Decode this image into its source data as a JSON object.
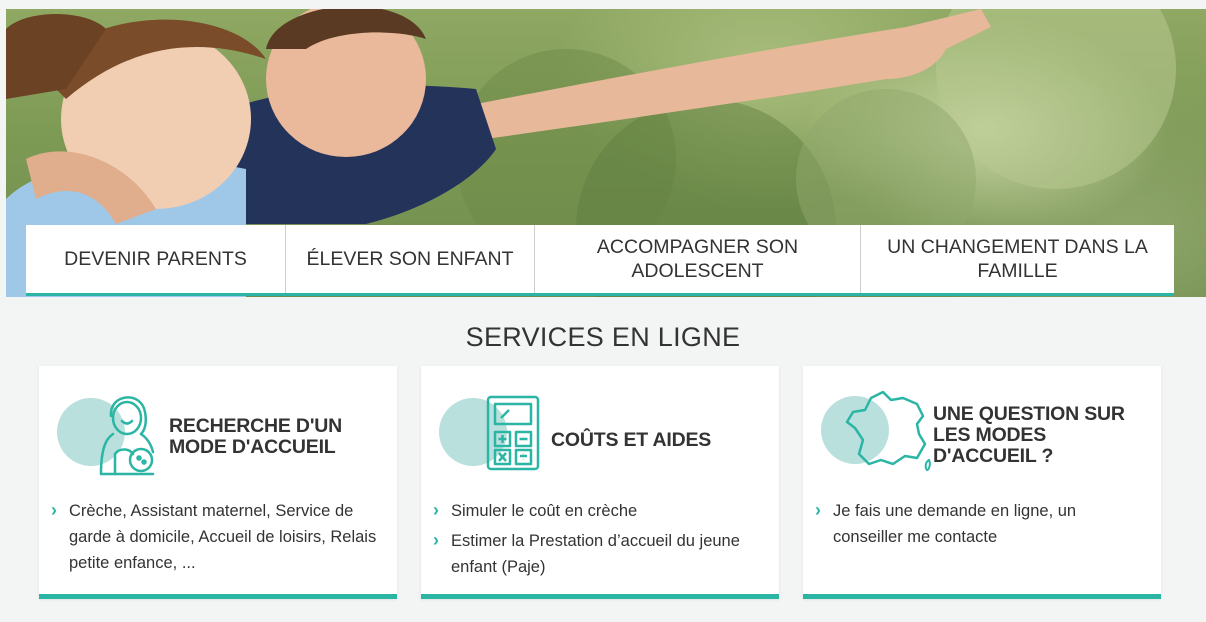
{
  "nav": {
    "items": [
      {
        "label": "DEVENIR PARENTS"
      },
      {
        "label": "ÉLEVER SON ENFANT"
      },
      {
        "label": "ACCOMPAGNER SON ADOLESCENT"
      },
      {
        "label": "UN CHANGEMENT DANS LA FAMILLE"
      }
    ]
  },
  "services": {
    "title": "SERVICES EN LIGNE",
    "cards": [
      {
        "icon": "childcare-woman-baby-icon",
        "title": "RECHERCHE D'UN MODE D'ACCUEIL",
        "links": [
          "Crèche, Assistant maternel, Service de garde à domicile, Accueil de loisirs, Relais petite enfance, ..."
        ]
      },
      {
        "icon": "calculator-icon",
        "title": "COÛTS ET AIDES",
        "links": [
          "Simuler le coût en crèche",
          "Estimer la Prestation d’accueil du jeune enfant (Paje)"
        ]
      },
      {
        "icon": "france-map-icon",
        "title": "UNE QUESTION SUR LES MODES D'ACCUEIL ?",
        "links": [
          "Je fais une demande en ligne, un conseiller me contacte"
        ]
      }
    ]
  },
  "colors": {
    "accent": "#2bb5a5",
    "icon_bg": "#b9e0dc",
    "page_bg": "#f3f4f4"
  }
}
